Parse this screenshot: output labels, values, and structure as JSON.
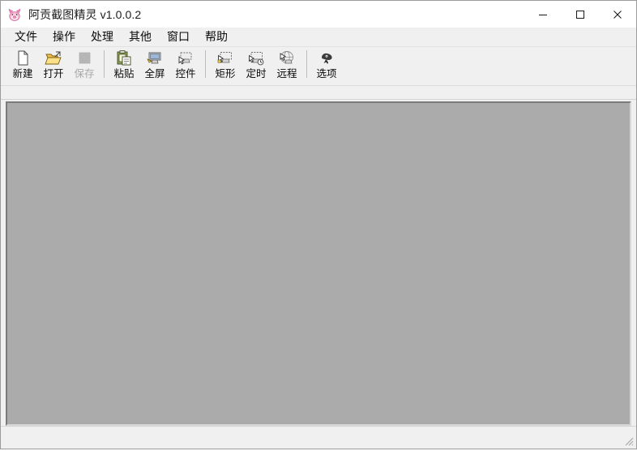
{
  "window": {
    "title": "阿贡截图精灵 v1.0.0.2",
    "app_icon": "pig-mascot-icon",
    "background_color": "#f0f0f0",
    "canvas_color": "#ababab"
  },
  "titlebar": {
    "controls": [
      {
        "name": "minimize-button",
        "glyph": "minimize-icon",
        "label": "最小化"
      },
      {
        "name": "maximize-button",
        "glyph": "maximize-icon",
        "label": "最大化"
      },
      {
        "name": "close-button",
        "glyph": "close-icon",
        "label": "关闭"
      }
    ]
  },
  "menubar": {
    "items": [
      {
        "label": "文件",
        "name": "menu-file"
      },
      {
        "label": "操作",
        "name": "menu-operation"
      },
      {
        "label": "处理",
        "name": "menu-process"
      },
      {
        "label": "其他",
        "name": "menu-other"
      },
      {
        "label": "窗口",
        "name": "menu-window"
      },
      {
        "label": "帮助",
        "name": "menu-help"
      }
    ]
  },
  "toolbar": {
    "buttons": [
      {
        "label": "新建",
        "icon": "new-document-icon",
        "enabled": true
      },
      {
        "label": "打开",
        "icon": "open-folder-icon",
        "enabled": true
      },
      {
        "label": "保存",
        "icon": "save-icon",
        "enabled": false
      },
      {
        "label": "粘贴",
        "icon": "paste-clipboard-icon",
        "enabled": true
      },
      {
        "label": "全屏",
        "icon": "fullscreen-capture-icon",
        "enabled": true
      },
      {
        "label": "控件",
        "icon": "control-capture-icon",
        "enabled": true
      },
      {
        "label": "矩形",
        "icon": "rectangle-capture-icon",
        "enabled": true
      },
      {
        "label": "定时",
        "icon": "timed-capture-icon",
        "enabled": true
      },
      {
        "label": "远程",
        "icon": "remote-capture-icon",
        "enabled": true
      },
      {
        "label": "选项",
        "icon": "options-icon",
        "enabled": true
      }
    ],
    "separators_after": [
      2,
      5,
      8
    ]
  },
  "statusbar": {
    "text": "",
    "grip": "resize-grip-icon"
  }
}
